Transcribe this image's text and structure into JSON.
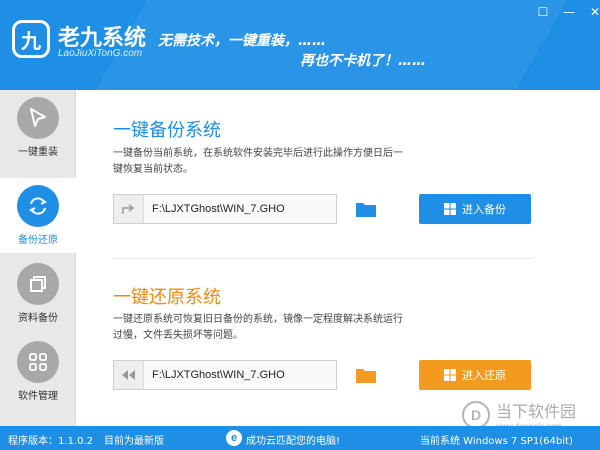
{
  "header": {
    "logo_glyph": "九",
    "brand": "老九系统",
    "brand_sub": "LaoJiuXiTonG.com",
    "slogan1": "无需技术，一键重装，……",
    "slogan2": "再也不卡机了！……",
    "controls": {
      "menu": "☐",
      "minimize": "—",
      "close": "✕"
    }
  },
  "sidebar": {
    "items": [
      {
        "label": "一键重装",
        "icon": "cursor-icon",
        "active": false
      },
      {
        "label": "备份还原",
        "icon": "sync-icon",
        "active": true
      },
      {
        "label": "资料备份",
        "icon": "copy-icon",
        "active": false
      },
      {
        "label": "软件管理",
        "icon": "grid-icon",
        "active": false
      }
    ]
  },
  "backup": {
    "title": "一键备份系统",
    "desc": "一键备份当前系统，在系统软件安装完毕后进行此操作方便日后一键恢复当前状态。",
    "path": "F:\\LJXTGhost\\WIN_7.GHO",
    "button": "进入备份"
  },
  "restore": {
    "title": "一键还原系统",
    "desc": "一键还原系统可恢复旧日备份的系统，镜像一定程度解决系统运行过慢，文件丢失损坏等问题。",
    "path": "F:\\LJXTGhost\\WIN_7.GHO",
    "button": "进入还原"
  },
  "status": {
    "version": "程序版本：1.1.0.2",
    "latest": "目前为最新版",
    "ie_glyph": "e",
    "cloud": "成功云匹配您的电脑!",
    "system": "当前系统 Windows 7 SP1(64bit)"
  },
  "watermark": {
    "glyph": "D",
    "text": "当下软件园",
    "sub": "www.downxia.com"
  },
  "colors": {
    "primary": "#1f8fe6",
    "accent_orange": "#f39a1f",
    "sidebar_bg": "#e8e8e8"
  }
}
